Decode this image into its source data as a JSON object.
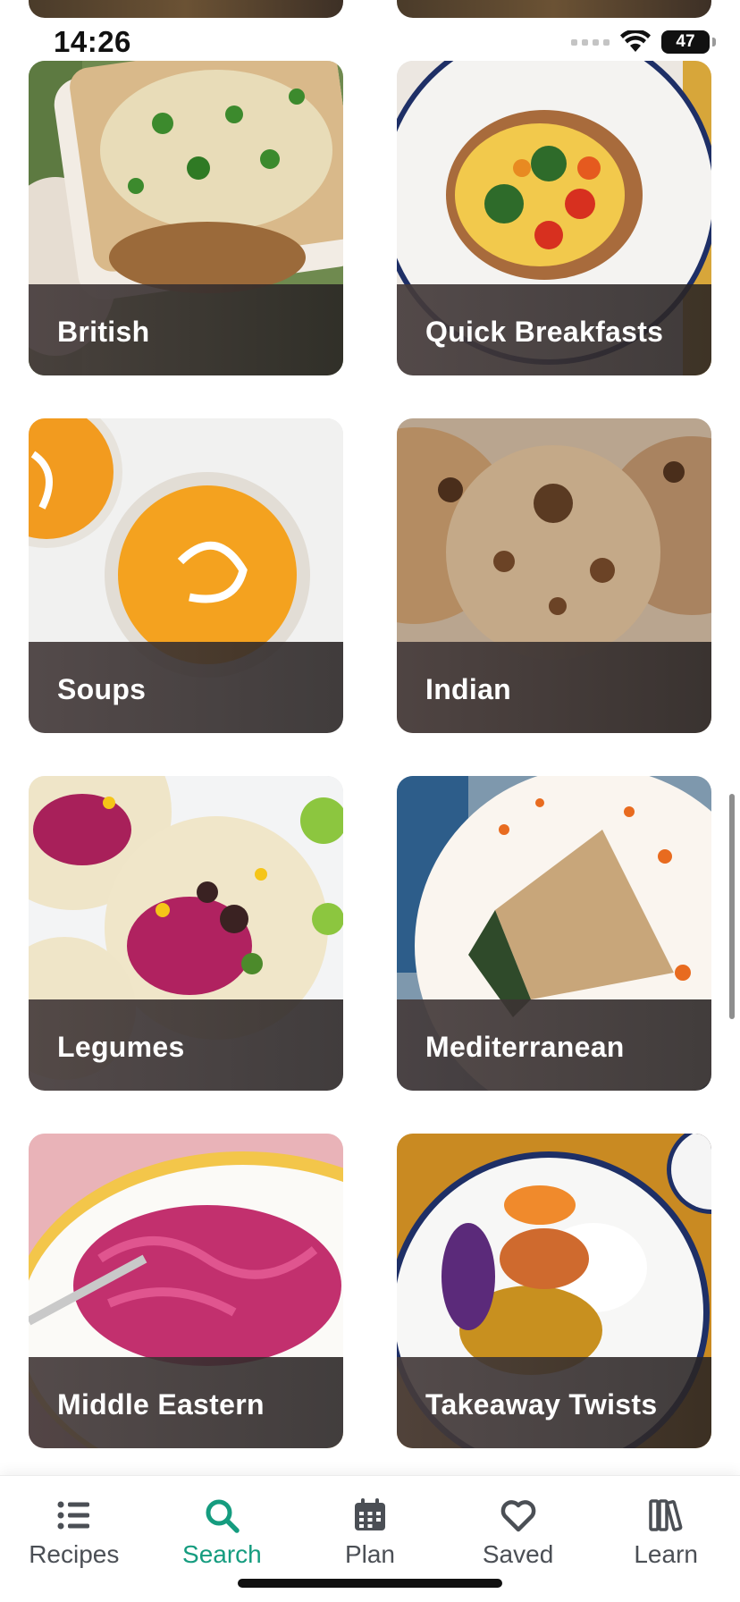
{
  "status_bar": {
    "time": "14:26",
    "battery": "47"
  },
  "categories": [
    {
      "label": "British"
    },
    {
      "label": "Quick Breakfasts"
    },
    {
      "label": "Soups"
    },
    {
      "label": "Indian"
    },
    {
      "label": "Legumes"
    },
    {
      "label": "Mediterranean"
    },
    {
      "label": "Middle Eastern"
    },
    {
      "label": "Takeaway Twists"
    }
  ],
  "tab_bar": {
    "items": [
      {
        "label": "Recipes",
        "icon": "list-icon"
      },
      {
        "label": "Search",
        "icon": "search-icon"
      },
      {
        "label": "Plan",
        "icon": "calendar-icon"
      },
      {
        "label": "Saved",
        "icon": "heart-icon"
      },
      {
        "label": "Learn",
        "icon": "books-icon"
      }
    ],
    "active": "Search"
  },
  "colors": {
    "accent": "#159c7f",
    "tab_inactive": "#4b4f55",
    "label_text": "#ffffff"
  }
}
